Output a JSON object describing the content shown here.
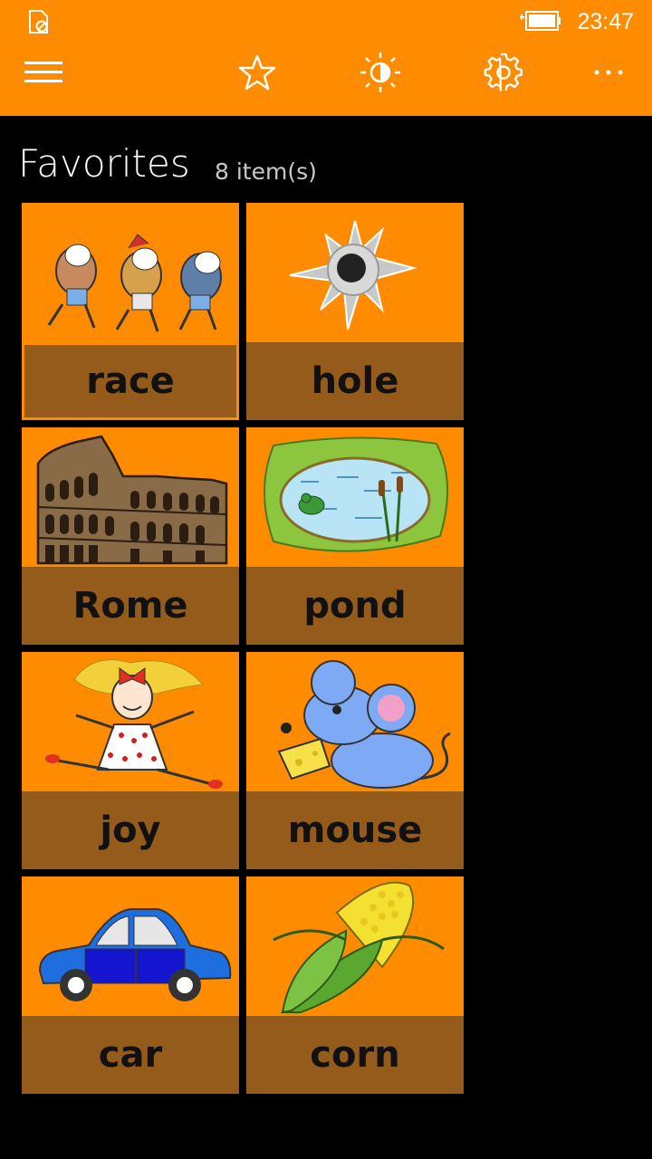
{
  "status_bar": {
    "time": "23:47",
    "left_icon": "notification-blocked-icon",
    "battery_icon": "battery-charging-icon"
  },
  "app_bar": {
    "buttons": [
      {
        "name": "menu-button",
        "icon": "hamburger-icon"
      },
      {
        "name": "favorites-button",
        "icon": "star-icon"
      },
      {
        "name": "brightness-button",
        "icon": "brightness-icon"
      },
      {
        "name": "settings-button",
        "icon": "gear-icon"
      },
      {
        "name": "more-button",
        "icon": "more-dots-icon"
      }
    ]
  },
  "page": {
    "title": "Favorites",
    "count": "8 item(s)"
  },
  "tiles": [
    {
      "label": "race",
      "picture": "racing-horses",
      "selected": true
    },
    {
      "label": "hole",
      "picture": "bullet-hole"
    },
    {
      "label": "Rome",
      "picture": "colosseum"
    },
    {
      "label": "pond",
      "picture": "pond-with-frog"
    },
    {
      "label": "joy",
      "picture": "jumping-girl"
    },
    {
      "label": "mouse",
      "picture": "mouse-with-cheese"
    },
    {
      "label": "car",
      "picture": "blue-car"
    },
    {
      "label": "corn",
      "picture": "corn-cob"
    }
  ],
  "colors": {
    "accent": "#FF8C00",
    "caption_bar": "#945B1A",
    "background": "#000000"
  }
}
